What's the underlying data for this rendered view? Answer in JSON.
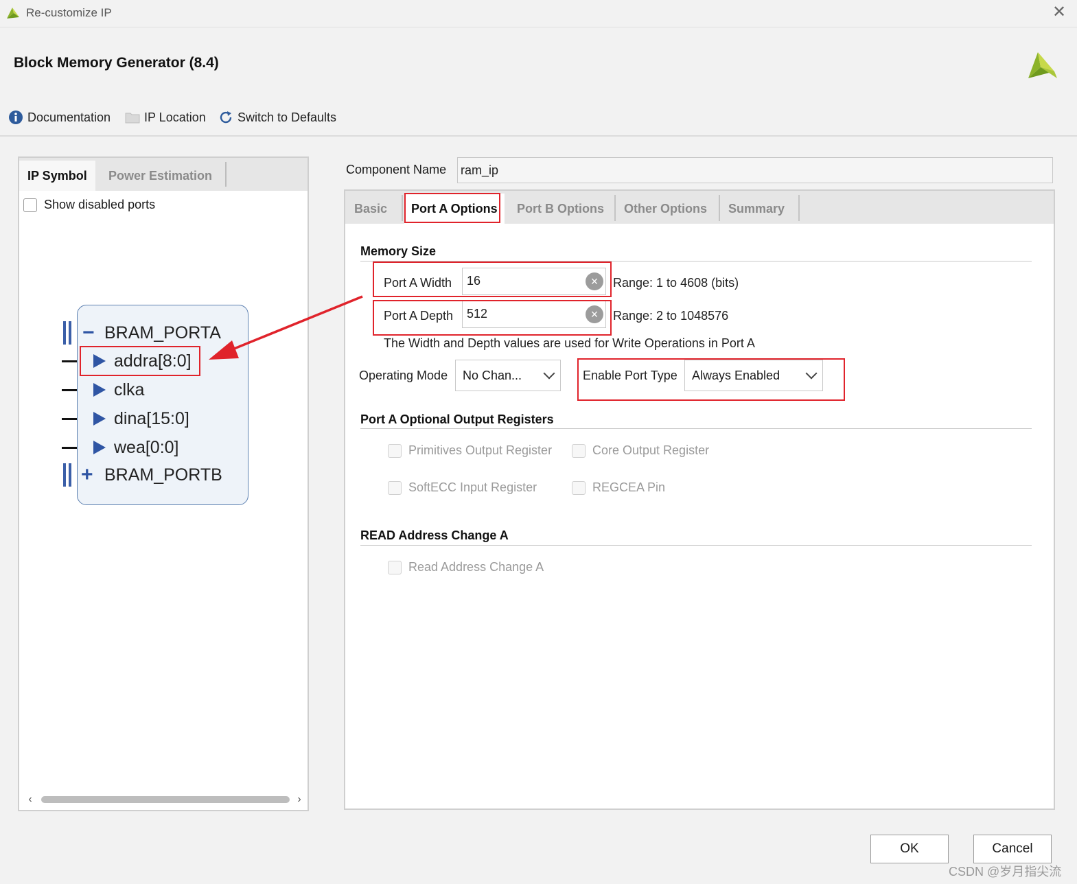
{
  "window": {
    "title": "Re-customize IP",
    "close_glyph": "✕"
  },
  "header": {
    "title": "Block Memory Generator (8.4)"
  },
  "toolbar": {
    "documentation": "Documentation",
    "ip_location": "IP Location",
    "switch_defaults": "Switch to Defaults"
  },
  "left_panel": {
    "tabs": [
      {
        "label": "IP Symbol",
        "active": true
      },
      {
        "label": "Power Estimation",
        "active": false
      }
    ],
    "show_disabled_ports": "Show disabled ports",
    "symbol": {
      "porta": {
        "toggle": "−",
        "label": "BRAM_PORTA"
      },
      "ports": [
        {
          "label": "addra[8:0]"
        },
        {
          "label": "clka"
        },
        {
          "label": "dina[15:0]"
        },
        {
          "label": "wea[0:0]"
        }
      ],
      "portb": {
        "toggle": "+",
        "label": "BRAM_PORTB"
      }
    },
    "scroll": {
      "left": "‹",
      "right": "›"
    }
  },
  "component": {
    "label": "Component Name",
    "value": "ram_ip"
  },
  "tabs": [
    {
      "label": "Basic",
      "active": false
    },
    {
      "label": "Port A Options",
      "active": true
    },
    {
      "label": "Port B Options",
      "active": false
    },
    {
      "label": "Other Options",
      "active": false
    },
    {
      "label": "Summary",
      "active": false
    }
  ],
  "memory_size": {
    "title": "Memory Size",
    "width_label": "Port A Width",
    "width_value": "16",
    "width_range": "Range: 1 to 4608 (bits)",
    "depth_label": "Port A Depth",
    "depth_value": "512",
    "depth_range": "Range: 2 to 1048576",
    "note": "The Width and Depth values are used for Write Operations in Port A"
  },
  "operating_mode": {
    "label": "Operating Mode",
    "value": "No Chan..."
  },
  "enable_port_type": {
    "label": "Enable Port Type",
    "value": "Always Enabled"
  },
  "optional_registers": {
    "title": "Port A Optional Output Registers",
    "primitives": "Primitives Output Register",
    "core": "Core Output Register",
    "softecc": "SoftECC Input Register",
    "regcea": "REGCEA Pin"
  },
  "read_address": {
    "title": "READ Address Change A",
    "checkbox": "Read Address Change A"
  },
  "buttons": {
    "ok": "OK",
    "cancel": "Cancel"
  },
  "watermark": "CSDN @岁月指尖流",
  "colors": {
    "highlight": "#e0232b",
    "port_blue": "#2f55a4",
    "brand_green": "#8cb32a"
  },
  "icons": {
    "documentation": "info-icon",
    "ip_location": "folder-icon",
    "switch_defaults": "refresh-icon"
  }
}
